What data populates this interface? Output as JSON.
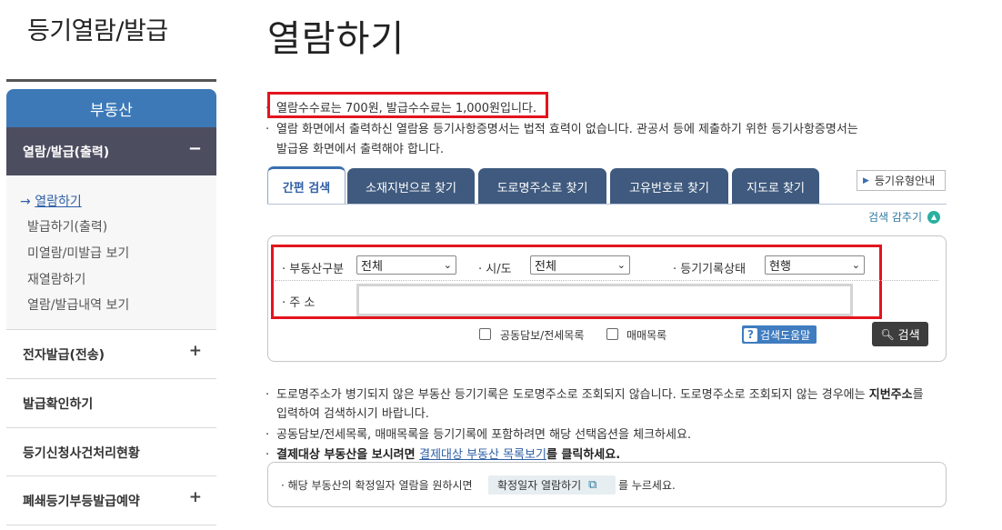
{
  "sidebar": {
    "title": "등기열람/발급",
    "header": "부동산",
    "active_menu": "열람/발급(출력)",
    "active_toggle": "−",
    "sub_items": [
      {
        "label": "열람하기",
        "current_marker": "→"
      },
      {
        "label": "발급하기(출력)"
      },
      {
        "label": "미열람/미발급 보기"
      },
      {
        "label": "재열람하기"
      },
      {
        "label": "열람/발급내역 보기"
      }
    ],
    "menus": [
      {
        "label": "전자발급(전송)",
        "toggle": "+"
      },
      {
        "label": "발급확인하기",
        "toggle": ""
      },
      {
        "label": "등기신청사건처리현황",
        "toggle": ""
      },
      {
        "label": "폐쇄등기부등발급예약",
        "toggle": "+"
      }
    ]
  },
  "main": {
    "title": "열람하기",
    "notices": [
      "열람수수료는 700원, 발급수수료는 1,000원입니다.",
      "열람 화면에서 출력하신 열람용 등기사항증명서는 법적 효력이 없습니다. 관공서 등에 제출하기 위한 등기사항증명서는",
      "발급용 화면에서 출력해야 합니다."
    ],
    "tabs": [
      "간편 검색",
      "소재지번으로 찾기",
      "도로명주소로 찾기",
      "고유번호로 찾기",
      "지도로 찾기"
    ],
    "guide_button": "등기유형안내",
    "hide_search": "검색 감추기",
    "form": {
      "type_label": "부동산구분",
      "type_value": "전체",
      "city_label": "시/도",
      "city_value": "전체",
      "status_label": "등기기록상태",
      "status_value": "현행",
      "address_label": "주 소",
      "address_value": "",
      "checkbox1": "공동담보/전세목록",
      "checkbox2": "매매목록",
      "help_button": "검색도움말",
      "search_button": "검색"
    },
    "info": {
      "line1a": "도로명주소가 병기되지 않은 부동산 등기기록은 도로명주소로 조회되지 않습니다. 도로명주소로 조회되지 않는 경우에는 ",
      "line1b": "지번주소",
      "line1c": "를",
      "line2": "입력하여 검색하시기 바랍니다.",
      "line3": "공동담보/전세목록, 매매목록을 등기기록에 포함하려면 해당 선택옵션을 체크하세요.",
      "line4a": "결제대상 부동산을 보시려면 ",
      "line4link": "결제대상 부동산 목록보기",
      "line4b": "를 클릭하세요."
    },
    "confirm": {
      "text": "해당 부동산의 확정일자 열람을 원하시면",
      "button": "확정일자 열람하기",
      "tail": "를 누르세요."
    }
  },
  "colors": {
    "brand_blue": "#3d79b7",
    "tab_navy": "#3f5a7e",
    "highlight_red": "#e3141d",
    "active_menu_bg": "#4d4d60"
  }
}
